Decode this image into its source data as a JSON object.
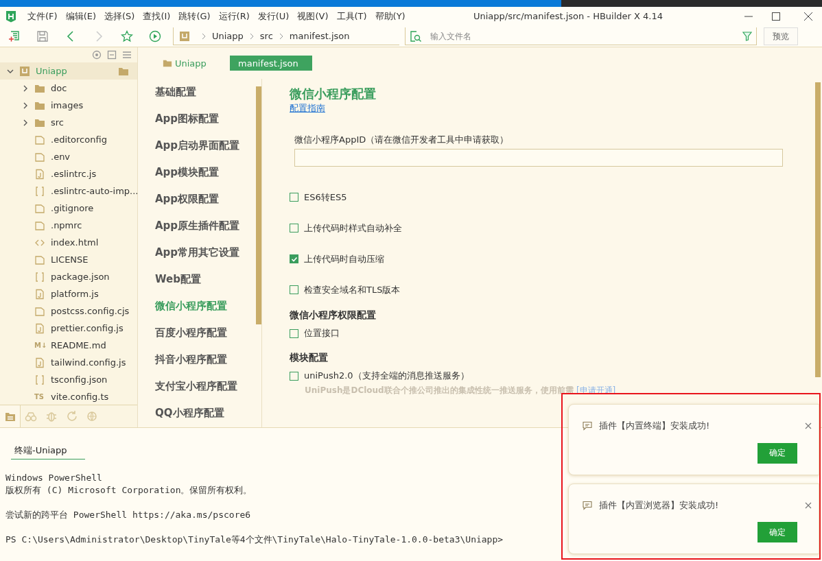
{
  "menu": [
    "文件(F)",
    "编辑(E)",
    "选择(S)",
    "查找(I)",
    "跳转(G)",
    "运行(R)",
    "发行(U)",
    "视图(V)",
    "工具(T)",
    "帮助(Y)"
  ],
  "window": {
    "title": "Uniapp/src/manifest.json - HBuilder X 4.14"
  },
  "toolbar": {
    "breadcrumb": [
      "Uniapp",
      "src",
      "manifest.json"
    ],
    "search": {
      "placeholder": "输入文件名"
    },
    "preview_button": "预览"
  },
  "sidebar": {
    "tree": [
      {
        "label": "Uniapp",
        "kind": "project",
        "expanded": true,
        "selected": true,
        "children": [
          {
            "label": "doc",
            "kind": "folder",
            "expanded": false,
            "selected": false
          },
          {
            "label": "images",
            "kind": "folder",
            "expanded": false,
            "selected": false
          },
          {
            "label": "src",
            "kind": "folder",
            "expanded": false,
            "selected": false
          },
          {
            "label": ".editorconfig",
            "kind": "file",
            "selected": false
          },
          {
            "label": ".env",
            "kind": "file",
            "selected": false
          },
          {
            "label": ".eslintrc.js",
            "kind": "js",
            "selected": false
          },
          {
            "label": ".eslintrc-auto-imp...",
            "kind": "json",
            "selected": false
          },
          {
            "label": ".gitignore",
            "kind": "file",
            "selected": false
          },
          {
            "label": ".npmrc",
            "kind": "file",
            "selected": false
          },
          {
            "label": "index.html",
            "kind": "html",
            "selected": false
          },
          {
            "label": "LICENSE",
            "kind": "file",
            "selected": false
          },
          {
            "label": "package.json",
            "kind": "json",
            "selected": false
          },
          {
            "label": "platform.js",
            "kind": "js",
            "selected": false
          },
          {
            "label": "postcss.config.cjs",
            "kind": "file",
            "selected": false
          },
          {
            "label": "prettier.config.js",
            "kind": "js",
            "selected": false
          },
          {
            "label": "README.md",
            "kind": "badge",
            "badge": "M↓",
            "selected": false
          },
          {
            "label": "tailwind.config.js",
            "kind": "js",
            "selected": false
          },
          {
            "label": "tsconfig.json",
            "kind": "json",
            "selected": false
          },
          {
            "label": "vite.config.ts",
            "kind": "badge",
            "badge": "TS",
            "selected": false
          }
        ]
      }
    ],
    "bottom_tabs": [
      {
        "kind": "files",
        "selected": true
      },
      {
        "kind": "binoculars",
        "selected": false
      },
      {
        "kind": "bug",
        "selected": false
      },
      {
        "kind": "sync",
        "selected": false
      },
      {
        "kind": "globe",
        "selected": false
      }
    ]
  },
  "editor_tabs": [
    {
      "label": "Uniapp",
      "kind": "folder",
      "selected": false
    },
    {
      "label": "manifest.json",
      "kind": "file",
      "selected": true
    }
  ],
  "nav": [
    {
      "label": "基础配置",
      "selected": false
    },
    {
      "label": "App图标配置",
      "selected": false
    },
    {
      "label": "App启动界面配置",
      "selected": false
    },
    {
      "label": "App模块配置",
      "selected": false
    },
    {
      "label": "App权限配置",
      "selected": false
    },
    {
      "label": "App原生插件配置",
      "selected": false
    },
    {
      "label": "App常用其它设置",
      "selected": false
    },
    {
      "label": "Web配置",
      "selected": false
    },
    {
      "label": "微信小程序配置",
      "selected": true
    },
    {
      "label": "百度小程序配置",
      "selected": false
    },
    {
      "label": "抖音小程序配置",
      "selected": false
    },
    {
      "label": "支付宝小程序配置",
      "selected": false
    },
    {
      "label": "QQ小程序配置",
      "selected": false
    }
  ],
  "content": {
    "title": "微信小程序配置",
    "guide_link": "配置指南",
    "appid_label": "微信小程序AppID（请在微信开发者工具中申请获取）",
    "options": [
      {
        "label": "ES6转ES5",
        "checked": false
      },
      {
        "label": "上传代码时样式自动补全",
        "checked": false
      },
      {
        "label": "上传代码时自动压缩",
        "checked": true
      },
      {
        "label": "检查安全域名和TLS版本",
        "checked": false
      }
    ],
    "permissions": {
      "title": "微信小程序权限配置",
      "options": [
        {
          "label": "位置接口",
          "checked": false
        }
      ]
    },
    "modules": {
      "title": "模块配置",
      "options": [
        {
          "label": "uniPush2.0（支持全端的消息推送服务）",
          "checked": false,
          "description": "UniPush是DCloud联合个推公司推出的集成性统一推送服务，使用前需",
          "link": "[申请开通]"
        }
      ]
    }
  },
  "terminal": {
    "tabs": [
      {
        "label": "终端-Uniapp",
        "selected": true
      }
    ],
    "paragraphs": [
      [
        "Windows PowerShell",
        "版权所有 (C) Microsoft Corporation。保留所有权利。"
      ],
      [
        "尝试新的跨平台 PowerShell https://aka.ms/pscore6"
      ],
      [
        "PS C:\\Users\\Administrator\\Desktop\\TinyTale等4个文件\\TinyTale\\Halo-TinyTale-1.0.0-beta3\\Uniapp>"
      ]
    ]
  },
  "notifications": [
    {
      "message": "插件【内置终端】安装成功!",
      "button": "确定"
    },
    {
      "message": "插件【内置浏览器】安装成功!",
      "button": "确定"
    }
  ]
}
